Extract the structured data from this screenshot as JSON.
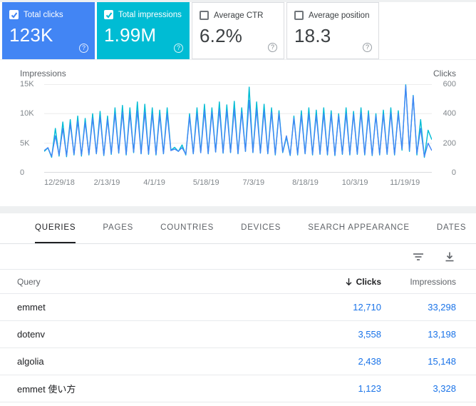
{
  "summary_cards": [
    {
      "label": "Total clicks",
      "value": "123K",
      "checked": true,
      "color": "#4285f4"
    },
    {
      "label": "Total impressions",
      "value": "1.99M",
      "checked": true,
      "color": "#00bcd4"
    },
    {
      "label": "Average CTR",
      "value": "6.2%",
      "checked": false,
      "color": "#ffffff"
    },
    {
      "label": "Average position",
      "value": "18.3",
      "checked": false,
      "color": "#ffffff"
    }
  ],
  "chart_data": {
    "type": "line",
    "grid": true,
    "y_left": {
      "label": "Impressions",
      "max": 15000,
      "ticks": [
        "15K",
        "10K",
        "5K",
        "0"
      ]
    },
    "y_right": {
      "label": "Clicks",
      "max": 600,
      "ticks": [
        "600",
        "400",
        "200",
        "0"
      ]
    },
    "x_ticks": [
      "12/29/18",
      "2/13/19",
      "4/1/19",
      "5/18/19",
      "7/3/19",
      "8/18/19",
      "10/3/19",
      "11/19/19"
    ],
    "series": [
      {
        "name": "Impressions",
        "axis": "left",
        "color": "#00bcd4",
        "values": [
          3600,
          4200,
          2600,
          7500,
          2800,
          8600,
          2700,
          9000,
          3000,
          9600,
          2800,
          9200,
          3000,
          10000,
          3200,
          10400,
          2900,
          9600,
          3100,
          11000,
          3300,
          11400,
          3000,
          11000,
          3400,
          12000,
          3200,
          11600,
          3100,
          11000,
          3000,
          10600,
          3200,
          11000,
          3800,
          4300,
          3600,
          4700,
          3000,
          10000,
          3200,
          11000,
          3400,
          11600,
          3200,
          11000,
          3500,
          12000,
          3300,
          11500,
          3400,
          12100,
          3200,
          11000,
          3600,
          14500,
          3400,
          12000,
          3300,
          11600,
          3200,
          11000,
          3000,
          10500,
          3400,
          6000,
          2900,
          9600,
          3000,
          10500,
          3200,
          11000,
          3000,
          10600,
          3100,
          11000,
          3000,
          10500,
          2900,
          10000,
          3100,
          11000,
          3000,
          10400,
          3100,
          11000,
          3000,
          10500,
          2900,
          10000,
          3000,
          10600,
          3100,
          11000,
          3000,
          10500,
          3800,
          14900,
          3600,
          13100,
          3000,
          9000,
          2600,
          7200,
          5600
        ]
      },
      {
        "name": "Clicks",
        "axis": "right",
        "color": "#4285f4",
        "values": [
          150,
          170,
          110,
          250,
          120,
          300,
          115,
          330,
          125,
          350,
          120,
          340,
          125,
          370,
          130,
          380,
          120,
          360,
          130,
          400,
          135,
          410,
          125,
          400,
          140,
          420,
          130,
          410,
          128,
          400,
          125,
          390,
          130,
          400,
          150,
          160,
          145,
          170,
          125,
          380,
          130,
          400,
          135,
          420,
          130,
          410,
          140,
          430,
          135,
          420,
          138,
          430,
          130,
          410,
          145,
          490,
          138,
          430,
          134,
          420,
          130,
          410,
          125,
          400,
          140,
          250,
          120,
          370,
          125,
          390,
          130,
          400,
          125,
          390,
          128,
          400,
          125,
          395,
          120,
          385,
          128,
          400,
          125,
          395,
          128,
          405,
          125,
          395,
          120,
          385,
          125,
          395,
          128,
          405,
          125,
          400,
          160,
          590,
          150,
          520,
          130,
          300,
          110,
          200,
          150
        ]
      }
    ]
  },
  "table": {
    "tabs": [
      {
        "label": "QUERIES",
        "active": true
      },
      {
        "label": "PAGES",
        "active": false
      },
      {
        "label": "COUNTRIES",
        "active": false
      },
      {
        "label": "DEVICES",
        "active": false
      },
      {
        "label": "SEARCH APPEARANCE",
        "active": false
      },
      {
        "label": "DATES",
        "active": false
      }
    ],
    "columns": {
      "query": "Query",
      "clicks": "Clicks",
      "impressions": "Impressions",
      "sorted_by": "Clicks",
      "sort_direction": "desc"
    },
    "rows": [
      {
        "query": "emmet",
        "clicks": "12,710",
        "impressions": "33,298"
      },
      {
        "query": "dotenv",
        "clicks": "3,558",
        "impressions": "13,198"
      },
      {
        "query": "algolia",
        "clicks": "2,438",
        "impressions": "15,148"
      },
      {
        "query": "emmet 使い方",
        "clicks": "1,123",
        "impressions": "3,328"
      }
    ]
  }
}
